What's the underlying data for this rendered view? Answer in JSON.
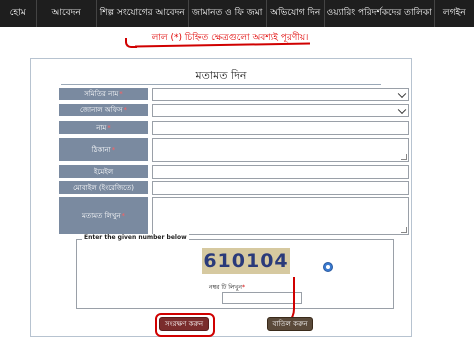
{
  "nav": {
    "items": [
      "হোম",
      "আবেদন",
      "শিল্প সংযোগের আবেদন",
      "জামানত ও ফি জমা",
      "অভিযোগ দিন",
      "ওয়্যারিং পরিদর্শকদের তালিকা",
      "লগইন"
    ]
  },
  "notice": "লাল (*) চিহ্নিত ক্ষেত্রগুলো অবশ্যই পূরণীয়।",
  "form": {
    "title": "মতামত দিন",
    "labels": {
      "samity": "সমিতির নাম",
      "zonal": "জোনাল অফিস",
      "name": "নাম",
      "address": "ঠিকানা",
      "email": "ইমেইল",
      "mobile": "মোবাইল (ইংরেজিতে)",
      "opinion": "মতামত লিখুন"
    },
    "required_mark": "*"
  },
  "captcha": {
    "legend": "Enter the given number below",
    "code": "610104",
    "label": "নম্বর টি লিখুন"
  },
  "buttons": {
    "save": "সংরক্ষণ করুন",
    "cancel": "বাতিল করুন"
  },
  "colors": {
    "nav_bg": "#1e1e1e",
    "label_bg": "#7a8aa0",
    "accent_red": "#d00000",
    "save_btn": "#7a2c2c",
    "cancel_btn": "#5a4a3a",
    "captcha_bg": "#d6c9a0"
  },
  "icons": [
    "refresh-icon",
    "chevron-down-icon"
  ]
}
